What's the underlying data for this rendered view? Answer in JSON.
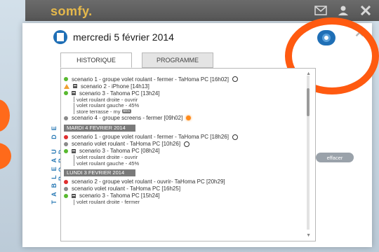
{
  "app": {
    "logo": "somfy."
  },
  "topbar": {
    "icons": [
      "envelope-icon",
      "user-icon",
      "close-icon"
    ]
  },
  "side_label": "TABLEAU DE BORD",
  "header": {
    "date": "mercredi 5 février 2014"
  },
  "tabs": [
    {
      "label": "HISTORIQUE",
      "active": true
    },
    {
      "label": "PROGRAMME",
      "active": false
    }
  ],
  "history": {
    "today_items": [
      {
        "text": "scenario 1 - groupe volet roulant - fermer - TaHoma PC [16h02]",
        "status": "green",
        "icon": "clock"
      },
      {
        "text": "scenario 2 - iPhone [14h13]",
        "status": "warning",
        "expand": true
      },
      {
        "text": "scenario 3 - Tahoma PC [13h24]",
        "status": "green",
        "expand": true,
        "subs": [
          "volet roulant droite - ouvrir",
          "volet roulant gauche - 45%",
          "store terrasse - my"
        ],
        "badge": "BIS"
      },
      {
        "text": "scenario 4 - groupe screens - fermer [09h02]",
        "status": "grey",
        "icon": "sun"
      }
    ],
    "day2": {
      "label": "MARDI 4 FEVRIER 2014",
      "items": [
        {
          "text": "scenario 1 - groupe volet roulant - fermer - TaHoma PC [18h26]",
          "status": "red",
          "icon": "clock"
        },
        {
          "text": "scenario volet roulant - TaHoma PC [10h26]",
          "status": "grey",
          "icon": "clock"
        },
        {
          "text": "scenario 3 - Tahoma PC [08h24]",
          "status": "green",
          "expand": true,
          "subs": [
            "volet roulant droite - ouvrir",
            "volet roulant gauche - 45%"
          ]
        }
      ]
    },
    "day3": {
      "label": "LUNDI 3 FEVRIER 2014",
      "items": [
        {
          "text": "scenario 2 - groupe volet roulant - ouvrir- TaHoma PC [20h29]",
          "status": "red"
        },
        {
          "text": "scenario volet roulant - TaHoma PC [16h25]",
          "status": "grey"
        },
        {
          "text": "scenario 3 - Tahoma PC [15h24]",
          "status": "green",
          "expand": true,
          "subs": [
            "volet roulant droite - fermer"
          ]
        }
      ]
    }
  },
  "effacer_label": "effacer",
  "colors": {
    "accent": "#1f6fb6",
    "annotation": "#ff5a10",
    "logo": "#e6b94b"
  }
}
